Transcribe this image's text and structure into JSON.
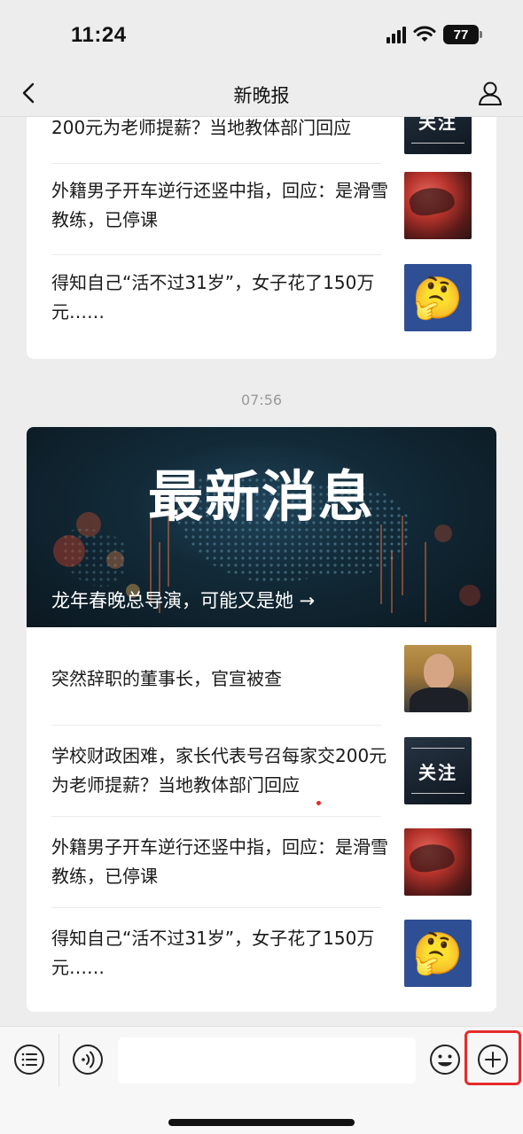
{
  "status_bar": {
    "time": "11:24",
    "battery": "77"
  },
  "nav": {
    "title": "新晚报"
  },
  "top_card": {
    "items": [
      {
        "title": "200元为老师提薪？当地教体部门回应",
        "thumb_label": "关注"
      },
      {
        "title": "外籍男子开车逆行还竖中指，回应：是滑雪教练，已停课"
      },
      {
        "title": "得知自己“活不过31岁”，女子花了150万元……",
        "thumb_emoji": "🤔"
      }
    ]
  },
  "timestamp": "07:56",
  "main_card": {
    "banner": {
      "title": "最新消息",
      "caption": "龙年春晚总导演，可能又是她 →"
    },
    "items": [
      {
        "title": "突然辞职的董事长，官宣被查"
      },
      {
        "title": "学校财政困难，家长代表号召每家交200元为老师提薪？当地教体部门回应",
        "thumb_label": "关注"
      },
      {
        "title": "外籍男子开车逆行还竖中指，回应：是滑雪教练，已停课"
      },
      {
        "title": "得知自己“活不过31岁”，女子花了150万元……",
        "thumb_emoji": "🤔"
      }
    ]
  },
  "input_bar": {
    "text_value": ""
  },
  "colors": {
    "background": "#ededed",
    "highlight": "#e62b2b",
    "card": "#ffffff"
  }
}
